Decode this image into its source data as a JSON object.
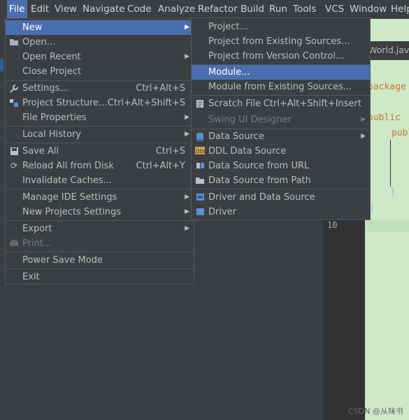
{
  "menubar": [
    "File",
    "Edit",
    "View",
    "Navigate",
    "Code",
    "Analyze",
    "Refactor",
    "Build",
    "Run",
    "Tools",
    "VCS",
    "Window",
    "Help"
  ],
  "file_menu": {
    "new": "New",
    "open": "Open...",
    "open_recent": "Open Recent",
    "close_project": "Close Project",
    "settings": "Settings...",
    "settings_sc": "Ctrl+Alt+S",
    "project_structure": "Project Structure...",
    "project_structure_sc": "Ctrl+Alt+Shift+S",
    "file_properties": "File Properties",
    "local_history": "Local History",
    "save_all": "Save All",
    "save_all_sc": "Ctrl+S",
    "reload": "Reload All from Disk",
    "reload_sc": "Ctrl+Alt+Y",
    "invalidate": "Invalidate Caches...",
    "manage_ide": "Manage IDE Settings",
    "new_projects": "New Projects Settings",
    "export": "Export",
    "print": "Print...",
    "power_save": "Power Save Mode",
    "exit": "Exit"
  },
  "new_menu": {
    "project": "Project...",
    "project_existing": "Project from Existing Sources...",
    "project_vcs": "Project from Version Control...",
    "module": "Module...",
    "module_existing": "Module from Existing Sources...",
    "scratch": "Scratch File",
    "scratch_sc": "Ctrl+Alt+Shift+Insert",
    "swing": "Swing UI Designer",
    "data_source": "Data Source",
    "ddl_data_source": "DDL Data Source",
    "data_source_url": "Data Source from URL",
    "data_source_path": "Data Source from Path",
    "driver_ds": "Driver and Data Source",
    "driver": "Driver"
  },
  "editor": {
    "tab": "World.java",
    "package_kw": "package",
    "public_kw": "public",
    "public_kw2": "publ",
    "line_number": "10",
    "brace1": "}",
    "brace2": "}"
  },
  "watermark": "CSDN @从味书"
}
